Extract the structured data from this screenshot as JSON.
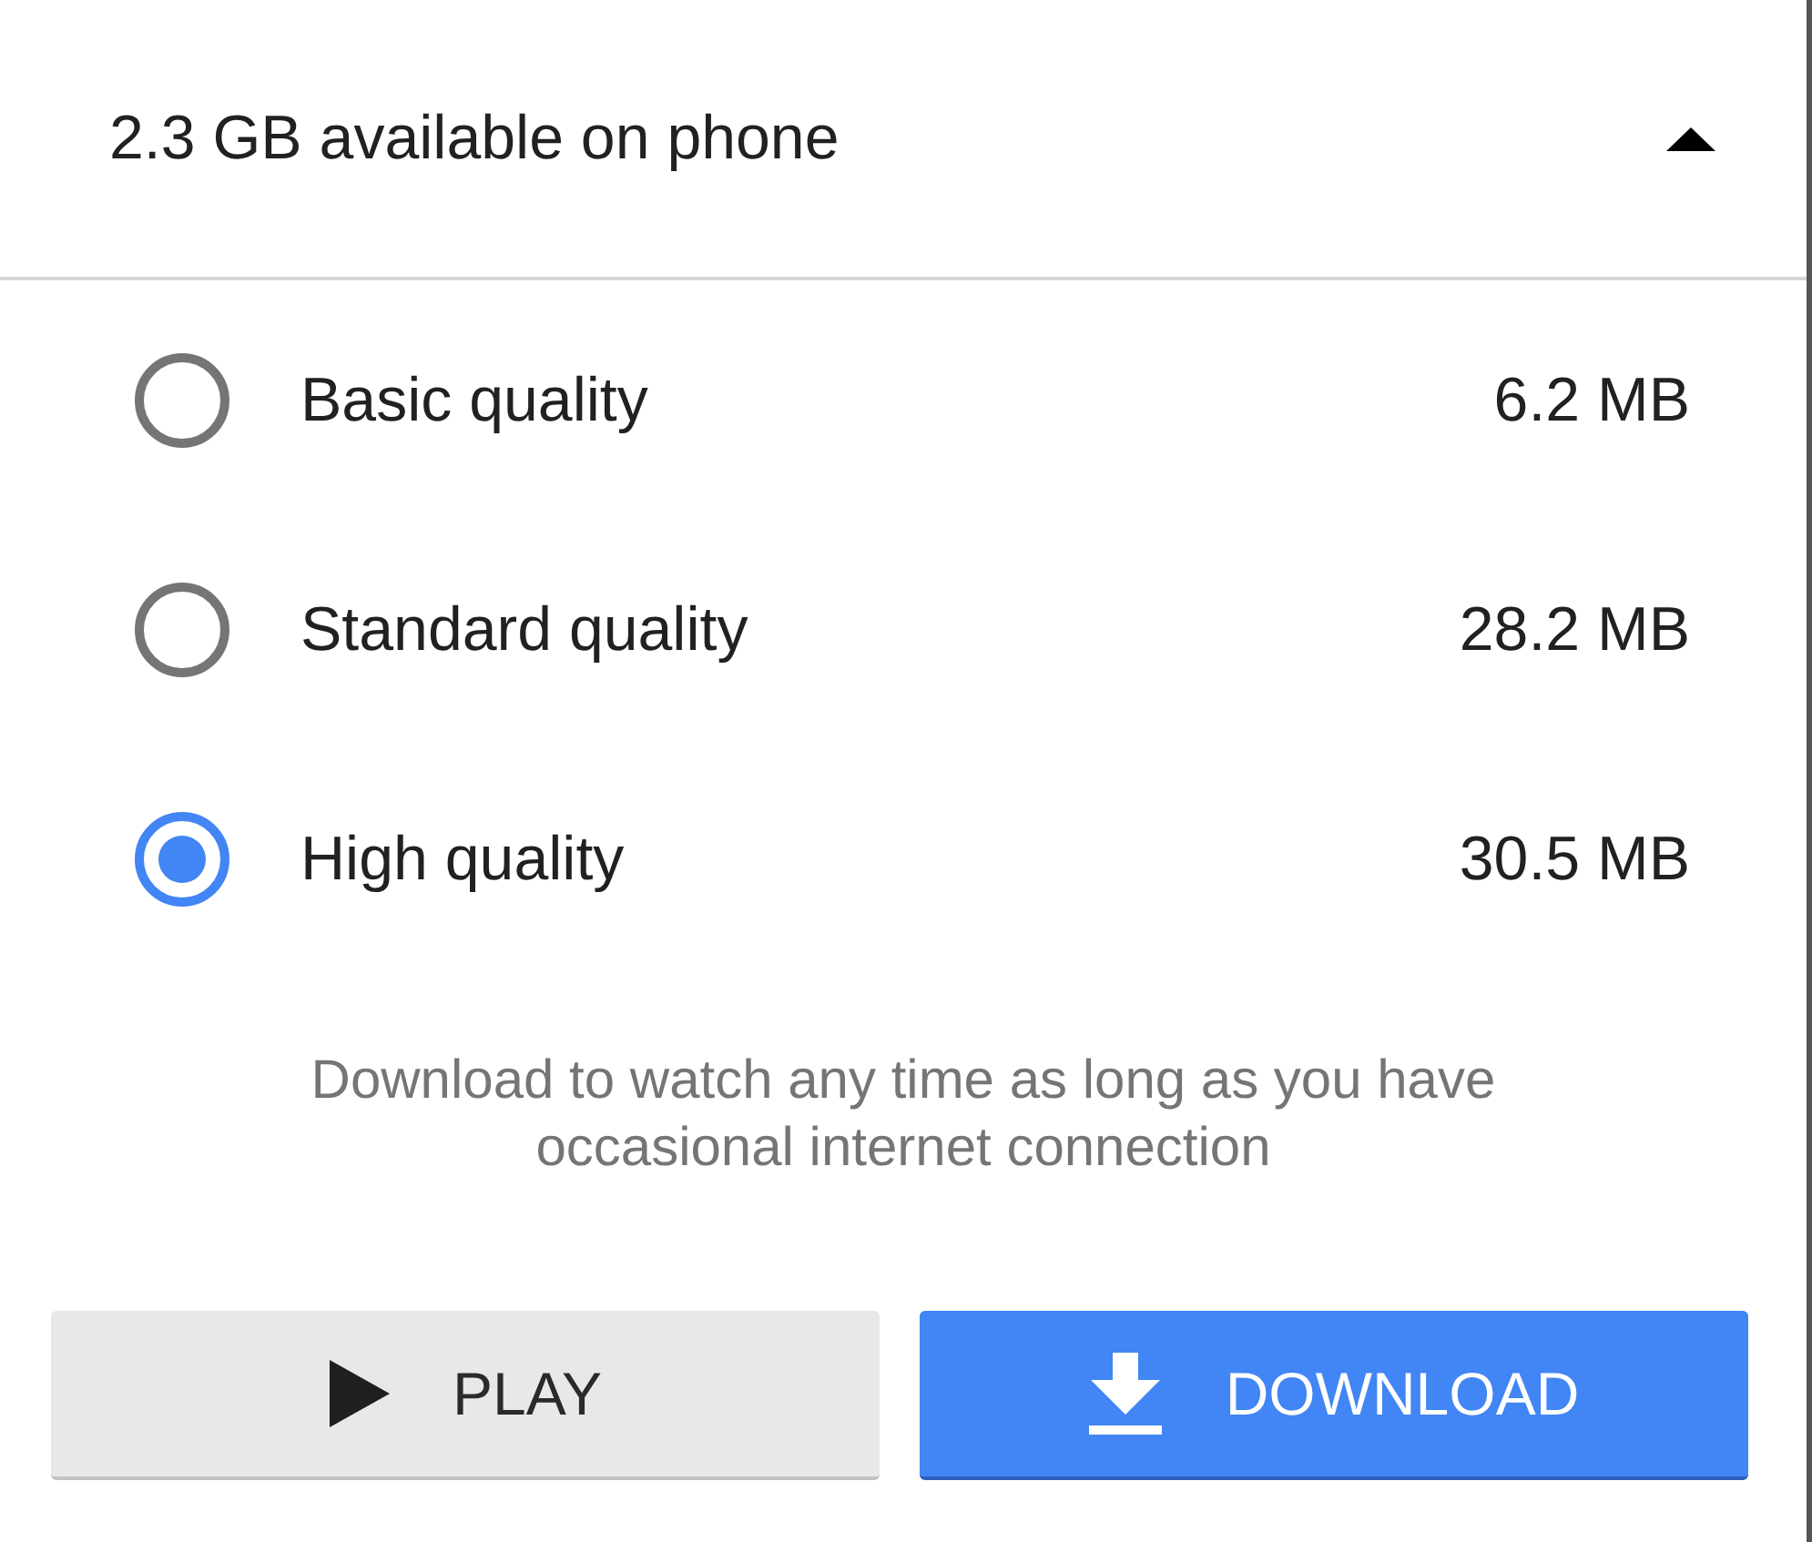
{
  "storage": {
    "label": "2.3 GB available on phone",
    "expanded": true
  },
  "options": [
    {
      "label": "Basic quality",
      "size": "6.2 MB",
      "selected": false
    },
    {
      "label": "Standard quality",
      "size": "28.2 MB",
      "selected": false
    },
    {
      "label": "High quality",
      "size": "30.5 MB",
      "selected": true
    }
  ],
  "note": "Download to watch any time as long as you have occasional internet connection",
  "buttons": [
    {
      "kind": "play",
      "label": "PLAY"
    },
    {
      "kind": "download",
      "label": "DOWNLOAD"
    }
  ]
}
